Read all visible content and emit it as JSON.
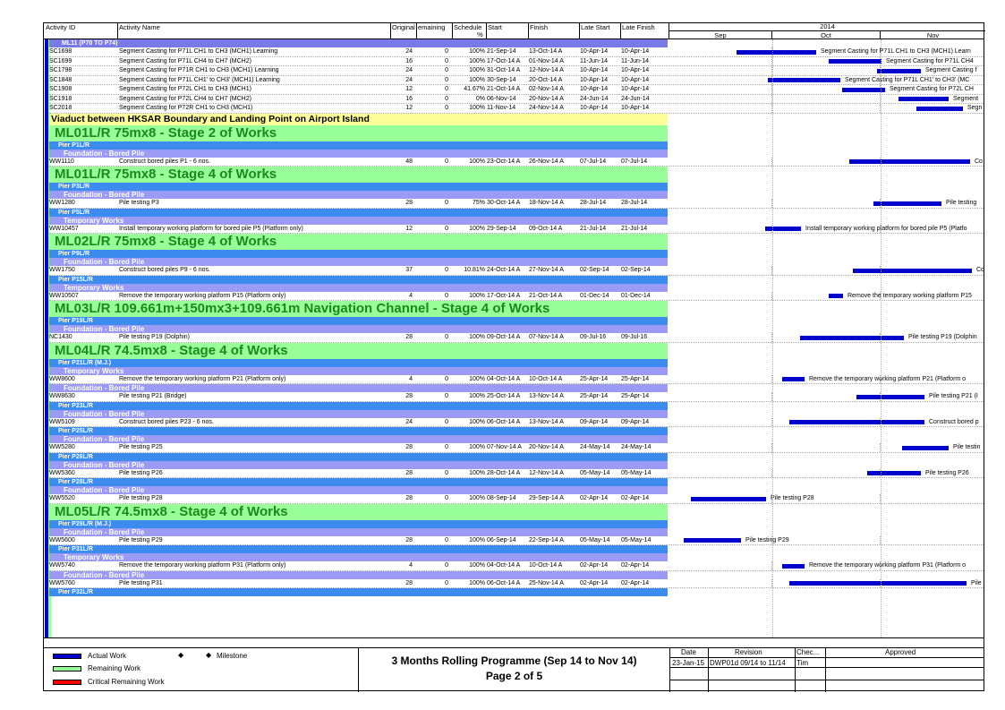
{
  "columns": {
    "activity_id": "Activity ID",
    "activity_name": "Activity Name",
    "original": "Original",
    "remaining": "emaining",
    "schedule": "Schedule",
    "schedule_pct": "%",
    "start": "Start",
    "finish": "Finish",
    "late_start": "Late Start",
    "late_finish": "Late Finish"
  },
  "timeline": {
    "year": "2014",
    "months": [
      "Sep",
      "Oct",
      "Nov"
    ]
  },
  "rows": [
    {
      "k": "wbs",
      "t": "ML11 (P70 TO P74)"
    },
    {
      "k": "act",
      "id": "SC1698",
      "name": "Segment Casting for P71L CH1 to CH3 (MCH1) Learning",
      "od": "24",
      "rd": "0",
      "pct": "100%",
      "st": "21-Sep-14",
      "fi": "13-Oct-14 A",
      "ls": "10-Apr-14",
      "lf": "10-Apr-14",
      "bs": 75,
      "be": 164,
      "lbl": "Segment Casting for P71L CH1 to CH3 (MCH1) Learn"
    },
    {
      "k": "act",
      "id": "SC1699",
      "name": "Segment Casting for P71L CH4 to CH7 (MCH2)",
      "od": "16",
      "rd": "0",
      "pct": "100%",
      "st": "17-Oct-14 A",
      "fi": "01-Nov-14 A",
      "ls": "11-Jun-14",
      "lf": "11-Jun-14",
      "bs": 178,
      "be": 237,
      "lbl": "Segment Casting for P71L CH4"
    },
    {
      "k": "act",
      "id": "SC1798",
      "name": "Segment Casting for P71R CH1 to CH3 (MCH1) Learning",
      "od": "24",
      "rd": "0",
      "pct": "100%",
      "st": "31-Oct-14 A",
      "fi": "12-Nov-14 A",
      "ls": "10-Apr-14",
      "lf": "10-Apr-14",
      "bs": 232,
      "be": 281,
      "lbl": "Segment Casting f"
    },
    {
      "k": "act",
      "id": "SC1848",
      "name": "Segment Casting for P71L CH1' to CH3' (MCH1) Learning",
      "od": "24",
      "rd": "0",
      "pct": "100%",
      "st": "30-Sep-14",
      "fi": "20-Oct-14 A",
      "ls": "10-Apr-14",
      "lf": "10-Apr-14",
      "bs": 110,
      "be": 191,
      "lbl": "Segment Casting for P71L CH1' to CH3' (MC"
    },
    {
      "k": "act",
      "id": "SC1908",
      "name": "Segment Casting for P72L CH1 to CH3 (MCH1)",
      "od": "12",
      "rd": "0",
      "pct": "41.67%",
      "st": "21-Oct-14 A",
      "fi": "02-Nov-14 A",
      "ls": "10-Apr-14",
      "lf": "10-Apr-14",
      "bs": 193,
      "be": 241,
      "lbl": "Segment Casting for P72L CH"
    },
    {
      "k": "act",
      "id": "SC1918",
      "name": "Segment Casting for P72L CH4 to CH7 (MCH2)",
      "od": "16",
      "rd": "0",
      "pct": "0%",
      "st": "06-Nov-14",
      "fi": "20-Nov-14 A",
      "ls": "24-Jun-14",
      "lf": "24-Jun-14",
      "bs": 256,
      "be": 312,
      "lbl": "Segment"
    },
    {
      "k": "act",
      "id": "SC2018",
      "name": "Segment Casting for P72R CH1 to CH3 (MCH1)",
      "od": "12",
      "rd": "0",
      "pct": "100%",
      "st": "11-Nov-14",
      "fi": "24-Nov-14 A",
      "ls": "10-Apr-14",
      "lf": "10-Apr-14",
      "bs": 276,
      "be": 328,
      "lbl": "Segn"
    },
    {
      "k": "h1",
      "t": "Viaduct between HKSAR Boundary and Landing Point on Airport Island"
    },
    {
      "k": "h2",
      "t": "ML01L/R 75mx8 - Stage 2 of Works"
    },
    {
      "k": "pier",
      "t": "Pier P1L/R"
    },
    {
      "k": "cat",
      "t": "Foundation - Bored Pile"
    },
    {
      "k": "act",
      "id": "WW1110",
      "name": "Construct bored piles P1 - 6 nos.",
      "od": "48",
      "rd": "0",
      "pct": "100%",
      "st": "23-Oct-14 A",
      "fi": "26-Nov-14 A",
      "ls": "07-Jul-14",
      "lf": "07-Jul-14",
      "bs": 201,
      "be": 336,
      "lbl": "Co"
    },
    {
      "k": "h2",
      "t": "ML01L/R 75mx8 - Stage 4 of Works"
    },
    {
      "k": "pier",
      "t": "Pier P3L/R"
    },
    {
      "k": "cat",
      "t": "Foundation - Bored Pile"
    },
    {
      "k": "act",
      "id": "WW1280",
      "name": "Pile testing P3",
      "od": "28",
      "rd": "0",
      "pct": "75%",
      "st": "30-Oct-14 A",
      "fi": "18-Nov-14 A",
      "ls": "28-Jul-14",
      "lf": "28-Jul-14",
      "bs": 228,
      "be": 304,
      "lbl": "Pile testing"
    },
    {
      "k": "pier",
      "t": "Pier P5L/R"
    },
    {
      "k": "cat",
      "t": "Temporary Works"
    },
    {
      "k": "act",
      "id": "WW10457",
      "name": "Install temporary working platform for bored pile P5 (Platform only)",
      "od": "12",
      "rd": "0",
      "pct": "100%",
      "st": "29-Sep-14",
      "fi": "09-Oct-14 A",
      "ls": "21-Jul-14",
      "lf": "21-Jul-14",
      "bs": 107,
      "be": 147,
      "lbl": "Install temporary working platform for bored pile P5 (Platfo"
    },
    {
      "k": "h2",
      "t": "ML02L/R 75mx8 - Stage 4 of Works"
    },
    {
      "k": "pier",
      "t": "Pier P9L/R"
    },
    {
      "k": "cat",
      "t": "Foundation - Bored Pile"
    },
    {
      "k": "act",
      "id": "WW1750",
      "name": "Construct bored piles P9 - 6 nos.",
      "od": "37",
      "rd": "0",
      "pct": "10.81%",
      "st": "24-Oct-14 A",
      "fi": "27-Nov-14 A",
      "ls": "02-Sep-14",
      "lf": "02-Sep-14",
      "bs": 205,
      "be": 338,
      "lbl": "Co"
    },
    {
      "k": "pier",
      "t": "Pier P15L/R"
    },
    {
      "k": "cat",
      "t": "Temporary Works"
    },
    {
      "k": "act",
      "id": "WW10507",
      "name": "Remove the temporary working platform P15 (Platform only)",
      "od": "4",
      "rd": "0",
      "pct": "100%",
      "st": "17-Oct-14 A",
      "fi": "21-Oct-14 A",
      "ls": "01-Dec-14",
      "lf": "01-Dec-14",
      "bs": 178,
      "be": 194,
      "lbl": "Remove the temporary working platform P15"
    },
    {
      "k": "h2",
      "t": "ML03L/R 109.661m+150mx3+109.661m Navigation Channel - Stage 4 of Works"
    },
    {
      "k": "pier",
      "t": "Pier P19L/R"
    },
    {
      "k": "cat",
      "t": "Foundation - Bored Pile"
    },
    {
      "k": "act",
      "id": "NC1430",
      "name": "Pile testing P19 (Dolphin)",
      "od": "28",
      "rd": "0",
      "pct": "100%",
      "st": "09-Oct-14 A",
      "fi": "07-Nov-14 A",
      "ls": "09-Jul-16",
      "lf": "09-Jul-16",
      "bs": 146,
      "be": 262,
      "lbl": "Pile testing P19 (Dolphin"
    },
    {
      "k": "h2",
      "t": "ML04L/R 74.5mx8 - Stage 4 of Works"
    },
    {
      "k": "pier",
      "t": "Pier P21L/R (M.J.)"
    },
    {
      "k": "cat",
      "t": "Temporary Works"
    },
    {
      "k": "act",
      "id": "WW8600",
      "name": "Remove the temporary working platform P21 (Platform only)",
      "od": "4",
      "rd": "0",
      "pct": "100%",
      "st": "04-Oct-14 A",
      "fi": "10-Oct-14 A",
      "ls": "25-Apr-14",
      "lf": "25-Apr-14",
      "bs": 126,
      "be": 151,
      "lbl": "Remove the temporary working platform P21 (Platform o"
    },
    {
      "k": "cat",
      "t": "Foundation - Bored Pile"
    },
    {
      "k": "act",
      "id": "WW8630",
      "name": "Pile testing P21 (Bridge)",
      "od": "28",
      "rd": "0",
      "pct": "100%",
      "st": "25-Oct-14 A",
      "fi": "13-Nov-14 A",
      "ls": "25-Apr-14",
      "lf": "25-Apr-14",
      "bs": 209,
      "be": 285,
      "lbl": "Pile testing P21 (I"
    },
    {
      "k": "pier",
      "t": "Pier P23L/R"
    },
    {
      "k": "cat",
      "t": "Foundation - Bored Pile"
    },
    {
      "k": "act",
      "id": "WW5109",
      "name": "Construct bored piles P23 - 6 nos.",
      "od": "24",
      "rd": "0",
      "pct": "100%",
      "st": "06-Oct-14 A",
      "fi": "13-Nov-14 A",
      "ls": "09-Apr-14",
      "lf": "09-Apr-14",
      "bs": 134,
      "be": 285,
      "lbl": "Construct bored p"
    },
    {
      "k": "pier",
      "t": "Pier P25L/R"
    },
    {
      "k": "cat",
      "t": "Foundation - Bored Pile"
    },
    {
      "k": "act",
      "id": "WW5280",
      "name": "Pile testing P25",
      "od": "28",
      "rd": "0",
      "pct": "100%",
      "st": "07-Nov-14 A",
      "fi": "20-Nov-14 A",
      "ls": "24-May-14",
      "lf": "24-May-14",
      "bs": 260,
      "be": 312,
      "lbl": "Pile testin"
    },
    {
      "k": "pier",
      "t": "Pier P26L/R"
    },
    {
      "k": "cat",
      "t": "Foundation - Bored Pile"
    },
    {
      "k": "act",
      "id": "WW5360",
      "name": "Pile testing P26",
      "od": "28",
      "rd": "0",
      "pct": "100%",
      "st": "28-Oct-14 A",
      "fi": "12-Nov-14 A",
      "ls": "05-May-14",
      "lf": "05-May-14",
      "bs": 221,
      "be": 281,
      "lbl": "Pile testing P26"
    },
    {
      "k": "pier",
      "t": "Pier P28L/R"
    },
    {
      "k": "cat",
      "t": "Foundation - Bored Pile"
    },
    {
      "k": "act",
      "id": "WW5520",
      "name": "Pile testing P28",
      "od": "28",
      "rd": "0",
      "pct": "100%",
      "st": "08-Sep-14",
      "fi": "29-Sep-14 A",
      "ls": "02-Apr-14",
      "lf": "02-Apr-14",
      "bs": 24,
      "be": 108,
      "lbl": "Pile testing P28"
    },
    {
      "k": "h2",
      "t": "ML05L/R 74.5mx8 - Stage 4 of Works"
    },
    {
      "k": "pier",
      "t": "Pier P29L/R (M.J.)"
    },
    {
      "k": "cat",
      "t": "Foundation - Bored Pile"
    },
    {
      "k": "act",
      "id": "WW5600",
      "name": "Pile testing P29",
      "od": "28",
      "rd": "0",
      "pct": "100%",
      "st": "06-Sep-14",
      "fi": "22-Sep-14 A",
      "ls": "05-May-14",
      "lf": "05-May-14",
      "bs": 16,
      "be": 80,
      "lbl": "Pile testing P29"
    },
    {
      "k": "pier",
      "t": "Pier P31L/R"
    },
    {
      "k": "cat",
      "t": "Temporary Works"
    },
    {
      "k": "act",
      "id": "WW5740",
      "name": "Remove the temporary working platform P31 (Platform only)",
      "od": "4",
      "rd": "0",
      "pct": "100%",
      "st": "04-Oct-14 A",
      "fi": "10-Oct-14 A",
      "ls": "02-Apr-14",
      "lf": "02-Apr-14",
      "bs": 126,
      "be": 151,
      "lbl": "Remove the temporary working platform P31 (Platform o"
    },
    {
      "k": "cat",
      "t": "Foundation - Bored Pile"
    },
    {
      "k": "act",
      "id": "WW5760",
      "name": "Pile testing P31",
      "od": "28",
      "rd": "0",
      "pct": "100%",
      "st": "06-Oct-14 A",
      "fi": "25-Nov-14 A",
      "ls": "02-Apr-14",
      "lf": "02-Apr-14",
      "bs": 134,
      "be": 332,
      "lbl": "Pile"
    },
    {
      "k": "pier",
      "t": "Pier P32L/R"
    }
  ],
  "legend": {
    "actual": "Actual Work",
    "remaining": "Remaining Work",
    "critical": "Critical Remaining Work",
    "milestone": "Milestone",
    "colors": {
      "actual": "#0000cc",
      "remaining": "#99ff99",
      "critical": "#ff0000"
    }
  },
  "title": {
    "line1": "3 Months Rolling Programme (Sep 14 to Nov 14)",
    "line2": "Page 2 of 5"
  },
  "revision": {
    "headers": [
      "Date",
      "Revision",
      "Chec...",
      "Approved"
    ],
    "row": [
      "23-Jan-15",
      "DWP01d 09/14 to 11/14",
      "Tim",
      ""
    ]
  }
}
